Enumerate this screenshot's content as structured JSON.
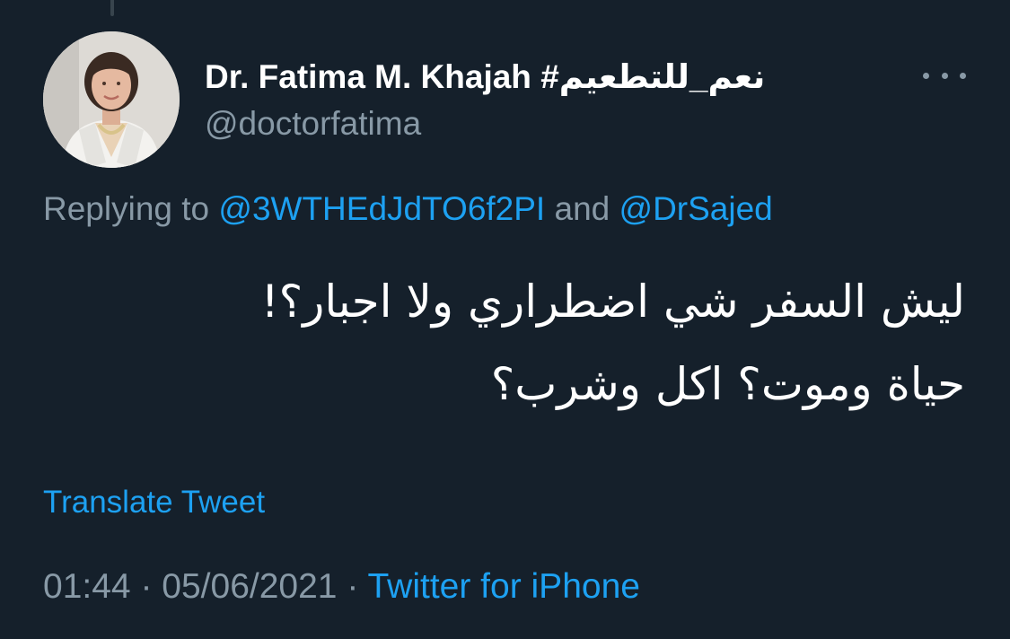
{
  "author": {
    "display_name": "Dr. Fatima M. Khajah #نعم_للتطعيم",
    "handle": "@doctorfatima",
    "avatar": "profile-photo"
  },
  "menu": {
    "icon": "more-horizontal-icon"
  },
  "reply": {
    "prefix": "Replying to",
    "mention_1": "@3WTHEdJdTO6f2PI",
    "conjunction": "and",
    "mention_2": "@DrSajed"
  },
  "tweet": {
    "lines": [
      "ليش السفر شي اضطراري ولا اجبار؟!",
      "حياة وموت؟ اكل وشرب؟"
    ]
  },
  "translate_label": "Translate Tweet",
  "meta": {
    "time": "01:44",
    "separator": "·",
    "date": "05/06/2021",
    "source": "Twitter for iPhone"
  },
  "colors": {
    "background": "#15202b",
    "accent": "#1da1f2",
    "secondary_text": "#8899a6",
    "primary_text": "#ffffff"
  }
}
